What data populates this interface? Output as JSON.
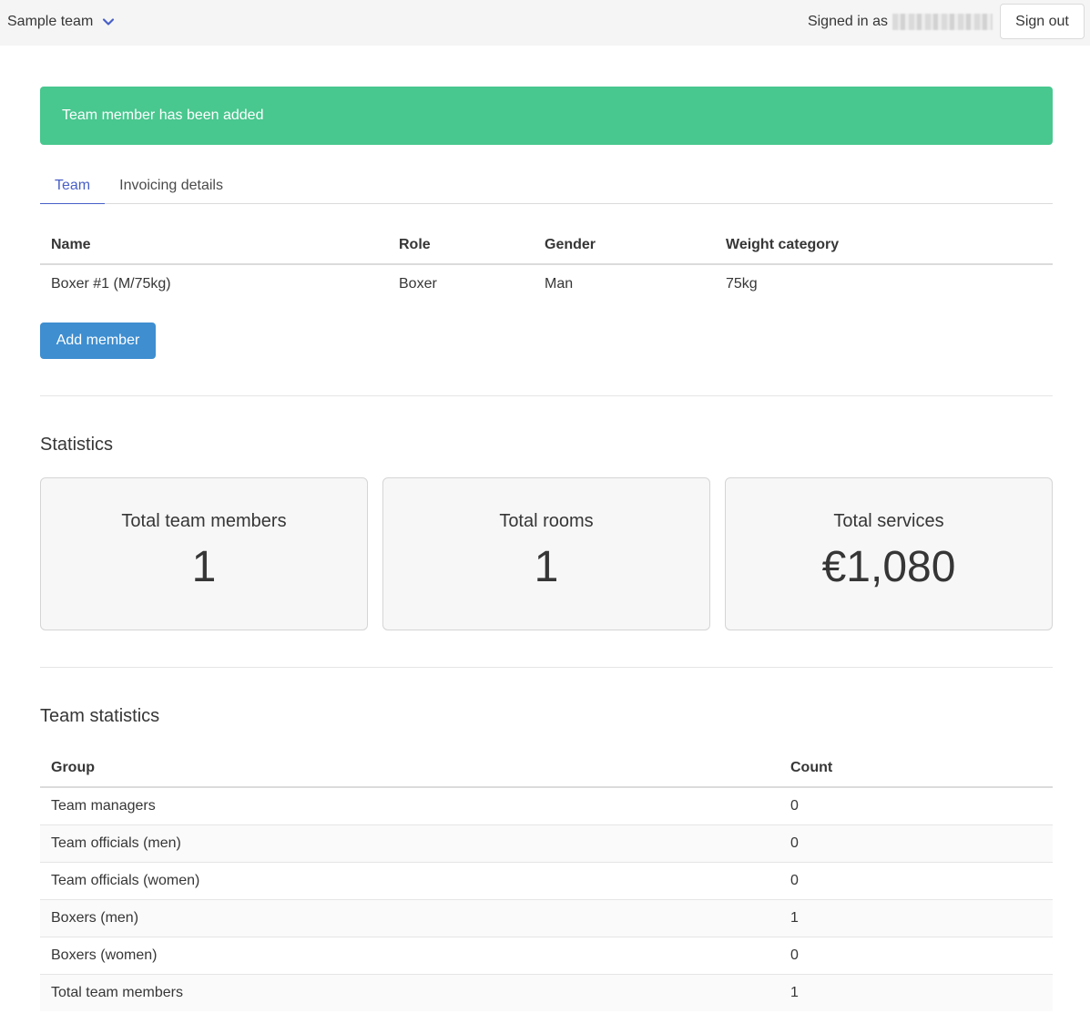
{
  "topbar": {
    "team_name": "Sample team",
    "signed_in_label": "Signed in as",
    "sign_out_label": "Sign out"
  },
  "notification": {
    "message": "Team member has been added",
    "color": "#48c78e"
  },
  "tabs": [
    {
      "label": "Team",
      "active": true
    },
    {
      "label": "Invoicing details",
      "active": false
    }
  ],
  "members_table": {
    "headers": [
      "Name",
      "Role",
      "Gender",
      "Weight category"
    ],
    "rows": [
      [
        "Boxer #1 (M/75kg)",
        "Boxer",
        "Man",
        "75kg"
      ]
    ]
  },
  "add_member_label": "Add member",
  "statistics": {
    "title": "Statistics",
    "cards": [
      {
        "label": "Total team members",
        "value": "1"
      },
      {
        "label": "Total rooms",
        "value": "1"
      },
      {
        "label": "Total services",
        "value": "€1,080"
      }
    ]
  },
  "team_statistics": {
    "title": "Team statistics",
    "headers": [
      "Group",
      "Count"
    ],
    "rows": [
      [
        "Team managers",
        "0"
      ],
      [
        "Team officials (men)",
        "0"
      ],
      [
        "Team officials (women)",
        "0"
      ],
      [
        "Boxers (men)",
        "1"
      ],
      [
        "Boxers (women)",
        "0"
      ],
      [
        "Total team members",
        "1"
      ]
    ]
  },
  "colors": {
    "primary_button": "#3e8ed0",
    "active_tab": "#485fc7",
    "topbar_bg": "#f5f5f5"
  },
  "icons": {
    "team_dropdown": "chevron-down-icon"
  }
}
